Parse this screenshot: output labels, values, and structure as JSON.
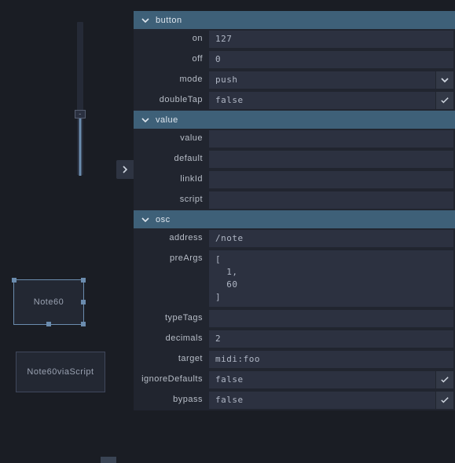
{
  "canvas": {
    "widgets": {
      "note60": "Note60",
      "note60via": "Note60viaScript"
    }
  },
  "sections": {
    "button": {
      "title": "button",
      "on": {
        "label": "on",
        "value": "127"
      },
      "off": {
        "label": "off",
        "value": "0"
      },
      "mode": {
        "label": "mode",
        "value": "push"
      },
      "doubleTap": {
        "label": "doubleTap",
        "value": "false"
      }
    },
    "value": {
      "title": "value",
      "value": {
        "label": "value",
        "value": ""
      },
      "default": {
        "label": "default",
        "value": ""
      },
      "linkId": {
        "label": "linkId",
        "value": ""
      },
      "script": {
        "label": "script",
        "value": ""
      }
    },
    "osc": {
      "title": "osc",
      "address": {
        "label": "address",
        "value": "/note"
      },
      "preArgs": {
        "label": "preArgs",
        "value": "[\n  1,\n  60\n]"
      },
      "typeTags": {
        "label": "typeTags",
        "value": ""
      },
      "decimals": {
        "label": "decimals",
        "value": "2"
      },
      "target": {
        "label": "target",
        "value": "midi:foo"
      },
      "ignoreDefaults": {
        "label": "ignoreDefaults",
        "value": "false"
      },
      "bypass": {
        "label": "bypass",
        "value": "false"
      }
    }
  }
}
